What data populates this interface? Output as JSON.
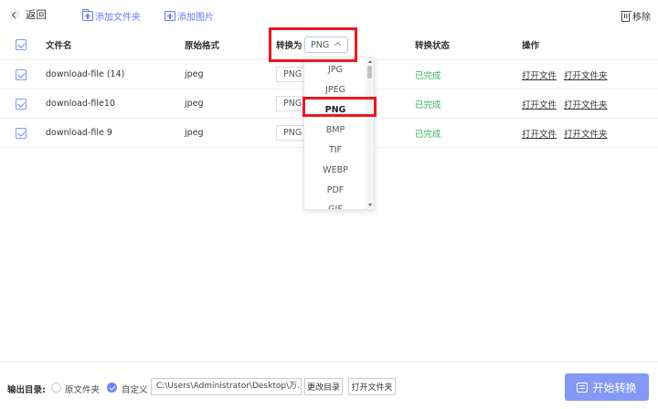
{
  "toolbar": {
    "back_label": "返回",
    "add_folder_label": "添加文件夹",
    "add_image_label": "添加图片",
    "remove_label": "移除"
  },
  "table": {
    "headers": {
      "file_name": "文件名",
      "original_format": "原始格式",
      "convert_to": "转换为",
      "status": "转换状态",
      "actions": "操作"
    },
    "convert_to_value": "PNG",
    "rows": [
      {
        "checked": true,
        "file_name": "download-file (14)",
        "original_format": "jpeg",
        "target": "PNG",
        "status": "已完成",
        "open_file": "打开文件",
        "open_folder": "打开文件夹"
      },
      {
        "checked": true,
        "file_name": "download-file10",
        "original_format": "jpeg",
        "target": "PNG",
        "status": "已完成",
        "open_file": "打开文件",
        "open_folder": "打开文件夹"
      },
      {
        "checked": true,
        "file_name": "download-file 9",
        "original_format": "jpeg",
        "target": "PNG",
        "status": "已完成",
        "open_file": "打开文件",
        "open_folder": "打开文件夹"
      }
    ]
  },
  "dropdown": {
    "options": [
      "JPG",
      "JPEG",
      "PNG",
      "BMP",
      "TIF",
      "WEBP",
      "PDF",
      "GIF"
    ],
    "selected": "PNG"
  },
  "footer": {
    "output_dir_label": "输出目录:",
    "option_original": "原文件夹",
    "option_custom": "自定义",
    "selected_option": "自定义",
    "path_value": "C:\\Users\\Administrator\\Desktop\\万...",
    "change_dir_label": "更改目录",
    "open_folder_label": "打开文件夹",
    "start_button_label": "开始转换"
  },
  "colors": {
    "accent": "#6b86f4",
    "start_button": "#8399f5",
    "status_done": "#2fb35a",
    "highlight": "#e8181f"
  }
}
